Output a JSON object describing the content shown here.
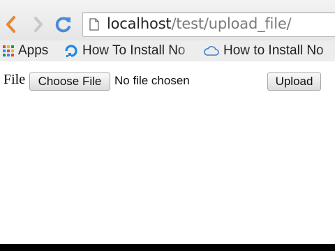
{
  "browser": {
    "url_host": "localhost",
    "url_path": "/test/upload_file/",
    "buttons": {
      "back": "back-icon",
      "forward": "forward-icon",
      "reload": "reload-icon"
    }
  },
  "bookmarks": [
    {
      "label": "Apps",
      "icon": "apps-grid-icon"
    },
    {
      "label": "How To Install No",
      "icon": "digitalocean-icon"
    },
    {
      "label": "How to Install No",
      "icon": "cloud-icon"
    }
  ],
  "form": {
    "field_label": "File",
    "choose_button": "Choose File",
    "file_status": "No file chosen",
    "upload_button": "Upload"
  },
  "colors": {
    "accent_back": "#e2893b",
    "reload_blue": "#4a8bd6"
  }
}
